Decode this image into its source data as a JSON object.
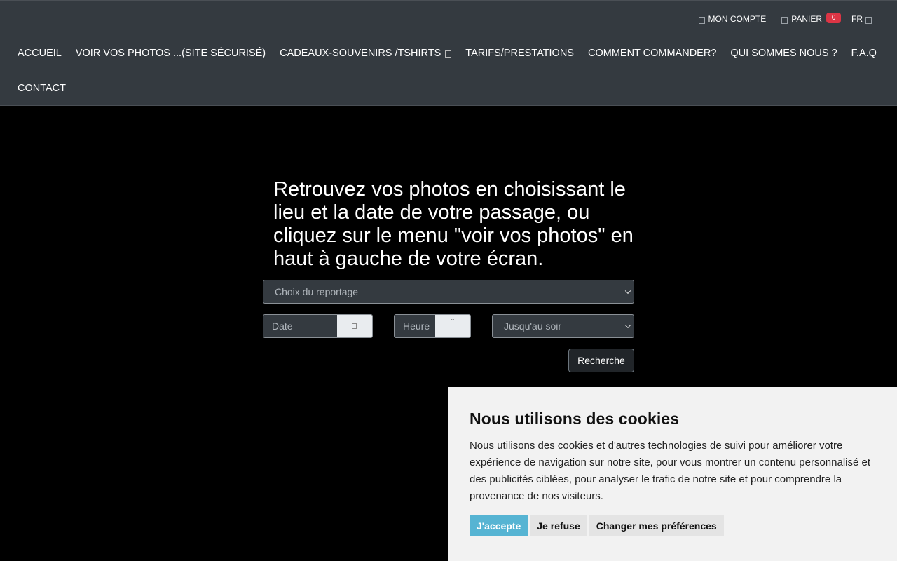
{
  "header": {
    "account_label": "MON COMPTE",
    "cart_label": "PANIER",
    "cart_count": "0",
    "lang_label": "FR"
  },
  "nav": {
    "items": [
      {
        "label": "ACCUEIL"
      },
      {
        "label": "VOIR VOS PHOTOS ...(SITE SÉCURISÉ)"
      },
      {
        "label": "CADEAUX-SOUVENIRS /TSHIRTS"
      },
      {
        "label": "TARIFS/PRESTATIONS"
      },
      {
        "label": "COMMENT COMMANDER?"
      },
      {
        "label": "QUI SOMMES NOUS ?"
      },
      {
        "label": "F.A.Q"
      },
      {
        "label": "CONTACT"
      }
    ]
  },
  "hero": {
    "text": "Retrouvez vos photos en choisissant le lieu et la date de votre passage, ou cliquez sur le menu \"voir vos photos\" en haut à gauche de votre écran."
  },
  "search": {
    "reportage_placeholder": "Choix du reportage",
    "date_placeholder": "Date",
    "time_placeholder": "Heure",
    "until_value": "Jusqu'au soir",
    "submit_label": "Recherche"
  },
  "cookie": {
    "title": "Nous utilisons des cookies",
    "body": "Nous utilisons des cookies et d'autres technologies de suivi pour améliorer votre expérience de navigation sur notre site, pour vous montrer un contenu personnalisé et des publicités ciblées, pour analyser le trafic de notre site et pour comprendre la provenance de nos visiteurs.",
    "accept_label": "J'accepte",
    "refuse_label": "Je refuse",
    "prefs_label": "Changer mes préférences"
  },
  "colors": {
    "header_bg": "#343a40",
    "badge": "#dc3545",
    "accept": "#56b4d3"
  }
}
